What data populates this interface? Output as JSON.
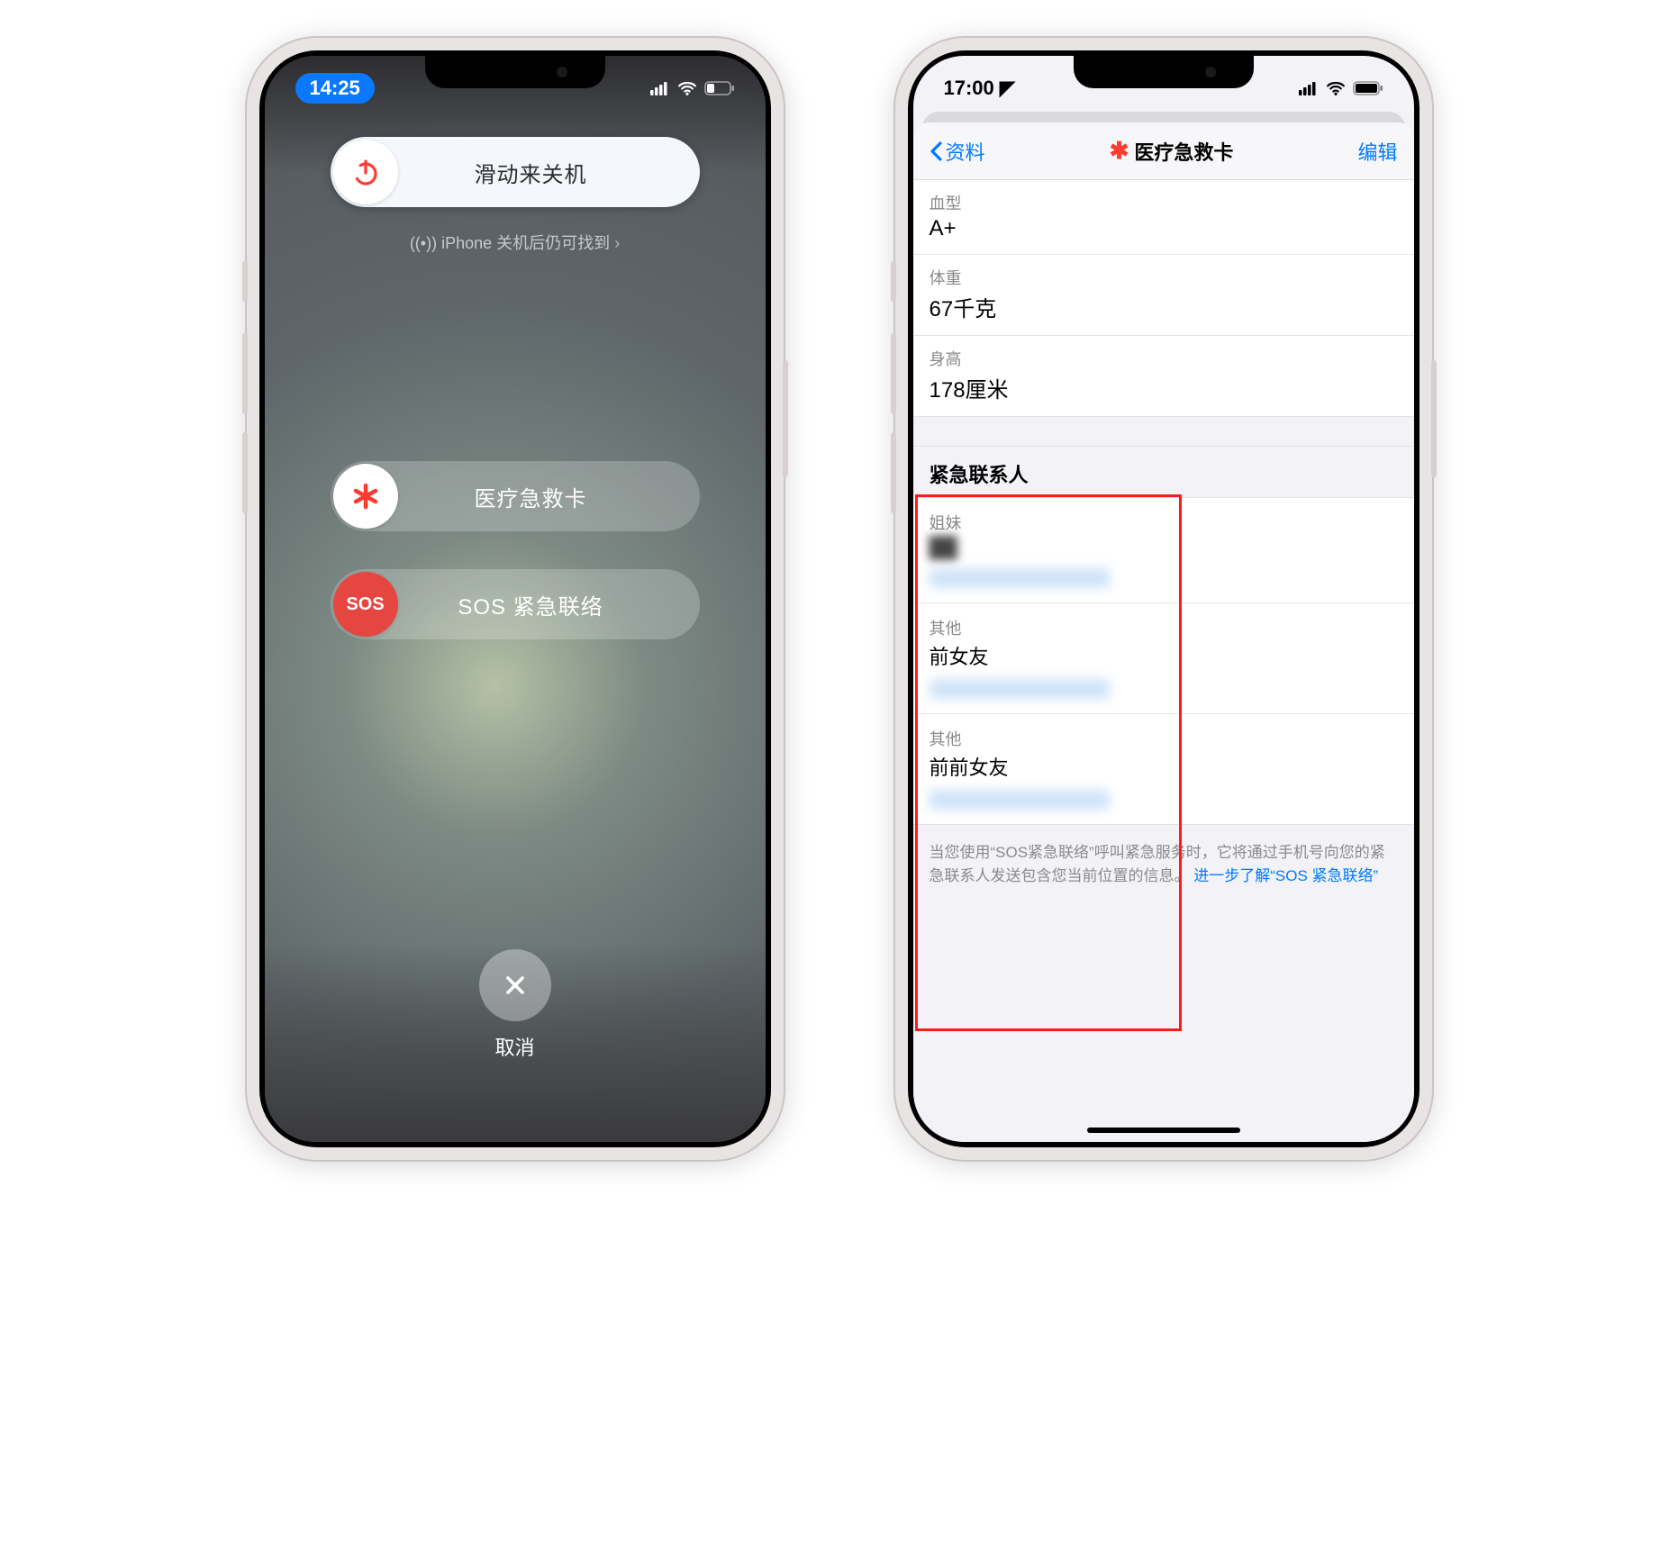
{
  "phone1": {
    "status": {
      "time": "14:25"
    },
    "power": {
      "label": "滑动来关机"
    },
    "subtext": "iPhone 关机后仍可找到",
    "medical": {
      "label": "医疗急救卡"
    },
    "sos": {
      "knob": "SOS",
      "label": "SOS 紧急联络"
    },
    "cancel": "取消"
  },
  "phone2": {
    "status": {
      "time": "17:00"
    },
    "nav": {
      "back": "资料",
      "title": "医疗急救卡",
      "edit": "编辑"
    },
    "info": [
      {
        "caption": "血型",
        "value": "A+"
      },
      {
        "caption": "体重",
        "value": "67千克"
      },
      {
        "caption": "身高",
        "value": "178厘米"
      }
    ],
    "contacts_header": "紧急联系人",
    "contacts": [
      {
        "relation": "姐妹",
        "name": "██"
      },
      {
        "relation": "其他",
        "name": "前女友"
      },
      {
        "relation": "其他",
        "name": "前前女友"
      }
    ],
    "footer_a": "当您使用“SOS紧急联络”呼叫紧急服务时，它将通过手机号向您的紧急联系人发送包含您当前位置的信息。",
    "footer_link": "进一步了解“SOS 紧急联络”"
  }
}
